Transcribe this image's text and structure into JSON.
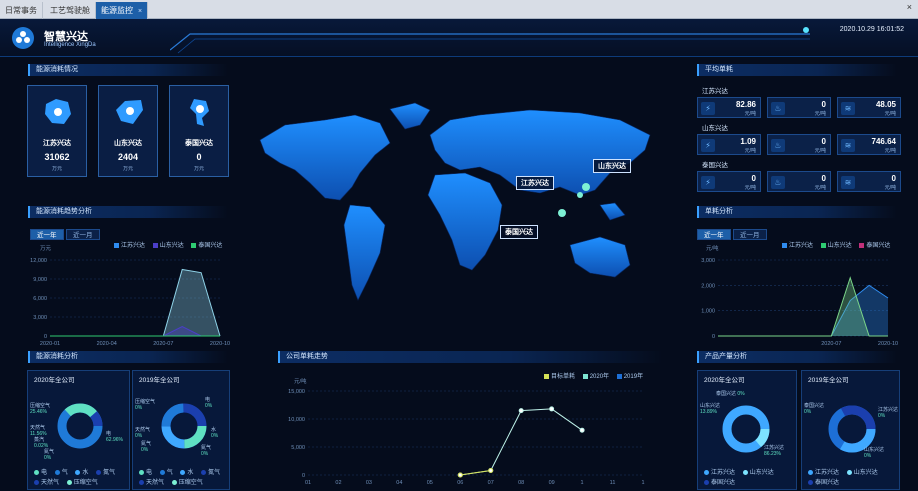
{
  "tabs": [
    {
      "label": "日常事务"
    },
    {
      "label": "工艺驾驶舱"
    },
    {
      "label": "能源监控"
    }
  ],
  "close_glyph": "×",
  "window_close": "×",
  "header": {
    "title": "智慧兴达",
    "subtitle": "Intelligence XingDa",
    "datetime": "2020.10.29 16:01:52"
  },
  "energy_status": {
    "title": "能源消耗情况",
    "cards": [
      {
        "name": "江苏兴达",
        "value": "31062",
        "unit": "万元"
      },
      {
        "name": "山东兴达",
        "value": "2404",
        "unit": "万元"
      },
      {
        "name": "泰国兴达",
        "value": "0",
        "unit": "万元"
      }
    ]
  },
  "trend": {
    "title": "能源消耗趋势分析",
    "tabs": [
      "近一年",
      "近一月"
    ],
    "unit": "万元",
    "legend": [
      "江苏兴达",
      "山东兴达",
      "泰国兴达"
    ]
  },
  "analysis": {
    "title": "能源消耗分析",
    "left": {
      "title": "2020年全公司",
      "labels": [
        {
          "name": "压缩空气",
          "pct": "25.46%"
        },
        {
          "name": "天然气",
          "pct": "11.56%"
        },
        {
          "name": "蒸汽",
          "pct": "0.02%"
        },
        {
          "name": "氮气",
          "pct": "0%"
        },
        {
          "name": "电",
          "pct": "62.96%"
        }
      ],
      "legend": [
        "电",
        "气",
        "水",
        "氮气",
        "天然气",
        "压缩空气"
      ]
    },
    "right": {
      "title": "2019年全公司",
      "labels": [
        {
          "name": "压缩空气",
          "pct": "0%"
        },
        {
          "name": "天然气",
          "pct": "0%"
        },
        {
          "name": "氮气",
          "pct": "0%"
        },
        {
          "name": "电",
          "pct": "0%"
        },
        {
          "name": "水",
          "pct": "0%"
        },
        {
          "name": "氮气",
          "pct": "0%"
        }
      ],
      "legend": [
        "电",
        "气",
        "水",
        "氮气",
        "天然气",
        "压缩空气"
      ]
    }
  },
  "map": {
    "labels": [
      "山东兴达",
      "江苏兴达",
      "泰国兴达"
    ]
  },
  "company_trend": {
    "title": "公司单耗走势",
    "unit": "元/吨",
    "legend": [
      "目标单耗",
      "2020年",
      "2019年"
    ]
  },
  "avg": {
    "title": "平均单耗",
    "groups": [
      {
        "name": "江苏兴达",
        "items": [
          {
            "value": "82.86",
            "unit": "元/吨"
          },
          {
            "value": "0",
            "unit": "元/吨"
          },
          {
            "value": "48.05",
            "unit": "元/吨"
          }
        ]
      },
      {
        "name": "山东兴达",
        "items": [
          {
            "value": "1.09",
            "unit": "元/吨"
          },
          {
            "value": "0",
            "unit": "元/吨"
          },
          {
            "value": "746.64",
            "unit": "元/吨"
          }
        ]
      },
      {
        "name": "泰国兴达",
        "items": [
          {
            "value": "0",
            "unit": "元/吨"
          },
          {
            "value": "0",
            "unit": "元/吨"
          },
          {
            "value": "0",
            "unit": "元/吨"
          }
        ]
      }
    ]
  },
  "unit_analysis": {
    "title": "单耗分析",
    "tabs": [
      "近一年",
      "近一月"
    ],
    "unit": "元/吨",
    "legend": [
      "江苏兴达",
      "山东兴达",
      "泰国兴达"
    ]
  },
  "output": {
    "title": "产品产量分析",
    "left": {
      "title": "2020年全公司",
      "labels": [
        {
          "name": "泰国兴达",
          "pct": "0%"
        },
        {
          "name": "山东兴达",
          "pct": "13.89%"
        },
        {
          "name": "江苏兴达",
          "pct": "86.23%"
        }
      ],
      "legend": [
        "江苏兴达",
        "山东兴达",
        "泰国兴达"
      ]
    },
    "right": {
      "title": "2019年全公司",
      "labels": [
        {
          "name": "泰国兴达",
          "pct": "0%"
        },
        {
          "name": "江苏兴达",
          "pct": "0%"
        },
        {
          "name": "山东兴达",
          "pct": "0%"
        }
      ],
      "legend": [
        "江苏兴达",
        "山东兴达",
        "泰国兴达"
      ]
    }
  },
  "colors": {
    "jiangsu": "#2f8cf0",
    "shandong": "#2ecc71",
    "thailand": "#c0307a",
    "target": "#d4e157",
    "y2020": "#7de3d0",
    "y2019": "#1d6fd6"
  },
  "chart_data": [
    {
      "type": "line",
      "title": "能源消耗趋势分析",
      "ylabel": "万元",
      "ylim": [
        0,
        12000
      ],
      "x": [
        "2020-01",
        "2020-02",
        "2020-03",
        "2020-04",
        "2020-05",
        "2020-06",
        "2020-07",
        "2020-08",
        "2020-09",
        "2020-10"
      ],
      "x_ticks": [
        "2020-01",
        "2020-04",
        "2020-07",
        "2020-10"
      ],
      "y_ticks": [
        "12,000",
        "9,000",
        "6,000",
        "3,000",
        "0"
      ],
      "series": [
        {
          "name": "江苏兴达",
          "values": [
            0,
            0,
            0,
            0,
            0,
            0,
            0,
            10500,
            10000,
            0
          ]
        },
        {
          "name": "山东兴达",
          "values": [
            0,
            0,
            0,
            0,
            0,
            0,
            0,
            1500,
            0,
            0
          ]
        },
        {
          "name": "泰国兴达",
          "values": [
            0,
            0,
            0,
            0,
            0,
            0,
            0,
            0,
            0,
            0
          ]
        }
      ]
    },
    {
      "type": "line",
      "title": "公司单耗走势",
      "ylabel": "元/吨",
      "ylim": [
        0,
        15000
      ],
      "x": [
        "01",
        "02",
        "03",
        "04",
        "05",
        "06",
        "07",
        "08",
        "09",
        "10",
        "11",
        "12"
      ],
      "x_ticks": [
        "01",
        "02",
        "03",
        "04",
        "05",
        "06",
        "07",
        "08",
        "09",
        "1",
        "11",
        "1"
      ],
      "y_ticks": [
        "15,000",
        "10,000",
        "5,000",
        "0"
      ],
      "series": [
        {
          "name": "2020年",
          "values": [
            null,
            null,
            null,
            null,
            null,
            0,
            800,
            11500,
            11800,
            8000,
            null,
            null
          ]
        },
        {
          "name": "目标单耗",
          "values": [
            null,
            null,
            null,
            null,
            null,
            0,
            800,
            null,
            null,
            null,
            null,
            null
          ]
        }
      ]
    },
    {
      "type": "line",
      "title": "单耗分析",
      "ylabel": "元/吨",
      "ylim": [
        0,
        3000
      ],
      "x": [
        "2020-01",
        "2020-02",
        "2020-03",
        "2020-04",
        "2020-05",
        "2020-06",
        "2020-07",
        "2020-08",
        "2020-09",
        "2020-10"
      ],
      "x_ticks": [
        "2020-07",
        "2020-10"
      ],
      "y_ticks": [
        "3,000",
        "2,000",
        "1,000",
        "0"
      ],
      "series": [
        {
          "name": "江苏兴达",
          "values": [
            0,
            0,
            0,
            0,
            0,
            0,
            0,
            1400,
            2000,
            1500
          ]
        },
        {
          "name": "山东兴达",
          "values": [
            0,
            0,
            0,
            0,
            0,
            0,
            0,
            2300,
            0,
            0
          ]
        }
      ]
    },
    {
      "type": "pie",
      "title": "2020年全公司",
      "categories": [
        "电",
        "压缩空气",
        "天然气",
        "蒸汽",
        "氮气"
      ],
      "values": [
        62.96,
        25.46,
        11.56,
        0.02,
        0
      ]
    },
    {
      "type": "pie",
      "title": "2020年全公司",
      "categories": [
        "江苏兴达",
        "山东兴达",
        "泰国兴达"
      ],
      "values": [
        86.23,
        13.89,
        0
      ]
    }
  ]
}
